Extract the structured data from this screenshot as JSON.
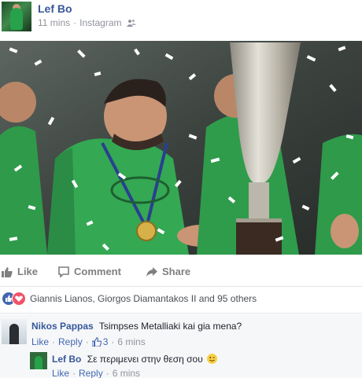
{
  "post": {
    "author": "Lef Bo",
    "time": "11 mins",
    "separator": "·",
    "source": "Instagram"
  },
  "actions": {
    "like": "Like",
    "comment": "Comment",
    "share": "Share"
  },
  "reactions": {
    "summary": "Giannis Lianos, Giorgos Diamantakos II and 95 others"
  },
  "comments": [
    {
      "author": "Nikos Pappas",
      "text": "Tsimpses Metalliaki kai gia mena?",
      "like_label": "Like",
      "reply_label": "Reply",
      "like_count": "3",
      "time": "6 mins"
    },
    {
      "author": "Lef Bo",
      "text": "Σε περιμενει στην θεση σου",
      "like_label": "Like",
      "reply_label": "Reply",
      "time": "6 mins"
    }
  ],
  "colors": {
    "link": "#365899",
    "action_gray": "#7f7f7f",
    "meta_gray": "#90949c",
    "like_blue": "#4267b2",
    "love_red": "#f25268",
    "jersey_green": "#27a24a"
  }
}
